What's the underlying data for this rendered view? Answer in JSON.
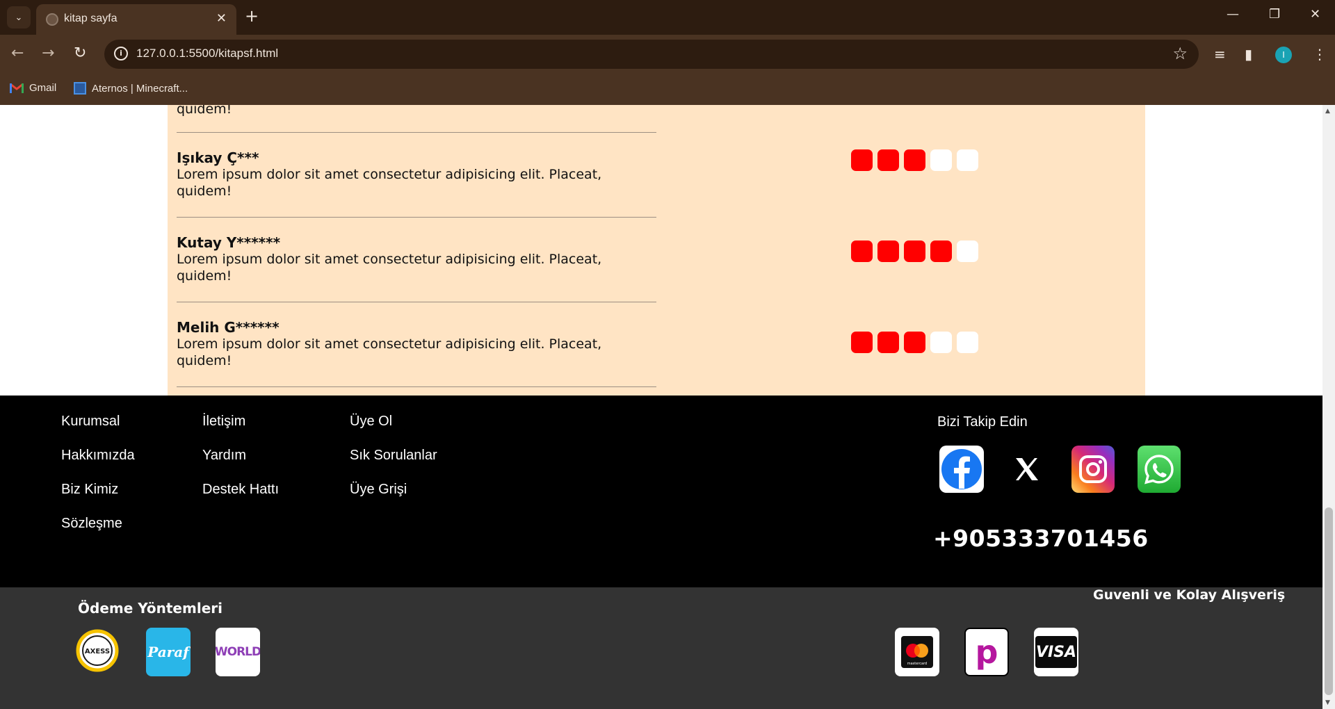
{
  "browser": {
    "tab_title": "kitap sayfa",
    "url": "127.0.0.1:5500/kitapsf.html",
    "profile_initial": "I",
    "bookmarks": [
      {
        "label": "Gmail"
      },
      {
        "label": "Aternos | Minecraft..."
      }
    ]
  },
  "reviews": {
    "partial_text": "quidem!",
    "items": [
      {
        "name": "Işıkay Ç***",
        "text": "Lorem ipsum dolor sit amet consectetur adipisicing elit. Placeat, quidem!",
        "rating": 3,
        "max": 5
      },
      {
        "name": "Kutay Y******",
        "text": "Lorem ipsum dolor sit amet consectetur adipisicing elit. Placeat, quidem!",
        "rating": 4,
        "max": 5
      },
      {
        "name": "Melih G******",
        "text": "Lorem ipsum dolor sit amet consectetur adipisicing elit. Placeat, quidem!",
        "rating": 3,
        "max": 5
      }
    ],
    "colors": {
      "background": "#ffe4c4",
      "star_on": "#ff0000",
      "star_off": "#ffffff"
    }
  },
  "footer": {
    "columns": [
      [
        "Kurumsal",
        "Hakkımızda",
        "Biz Kimiz",
        "Sözleşme"
      ],
      [
        "İletişim",
        "Yardım",
        "Destek Hattı"
      ],
      [
        "Üye Ol",
        "Sık Sorulanlar",
        "Üye Grişi"
      ]
    ],
    "follow_title": "Bizi Takip Edin",
    "social": [
      "facebook-icon",
      "x-icon",
      "instagram-icon",
      "whatsapp-icon"
    ],
    "phone": "+905333701456",
    "payment_title": "Ödeme Yöntemleri",
    "secure_title": "Guvenli ve Kolay Alışveriş",
    "payment_logos_left": [
      {
        "icon": "axess-logo",
        "text": "AXESS"
      },
      {
        "icon": "paraf-logo",
        "text": "Paraf"
      },
      {
        "icon": "world-logo",
        "text": "WORLD"
      }
    ],
    "payment_logos_right": [
      {
        "icon": "mastercard-logo",
        "text": "mastercard"
      },
      {
        "icon": "papara-logo",
        "text": "p"
      },
      {
        "icon": "visa-logo",
        "text": "VISA"
      }
    ]
  }
}
